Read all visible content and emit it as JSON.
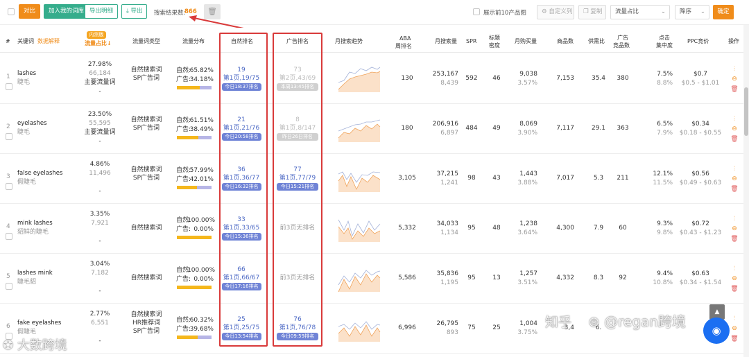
{
  "toolbar": {
    "btn_compare": "对比",
    "btn_add_library": "加入我的词库",
    "btn_export_detail": "导出明细",
    "btn_export": "导出",
    "search_result_label": "搜索结果数:",
    "search_result_count": "866",
    "show_top10": "展示前10产品图",
    "custom_columns": "自定义列",
    "copy": "复制",
    "sort_field": "流量占比",
    "sort_order": "降序",
    "confirm": "确定"
  },
  "headers": {
    "index": "#",
    "keyword": "关键词",
    "data_explain": "数据解释",
    "traffic_share": "流量占比",
    "internal_badge": "内测版",
    "traffic_type": "流量词类型",
    "traffic_dist": "流量分布",
    "natural_rank": "自然排名",
    "ad_rank": "广告排名",
    "monthly_trend": "月搜索趋势",
    "aba_1": "ABA",
    "aba_2": "周排名",
    "monthly_search": "月搜索量",
    "spr": "SPR",
    "title_1": "标题",
    "title_2": "密度",
    "monthly_buy": "月购买量",
    "products": "商品数",
    "supply_demand": "供需比",
    "ad_1": "广告",
    "ad_2": "竞品数",
    "click_1": "点击",
    "click_2": "集中度",
    "ppc": "PPC竞价",
    "ops": "操作"
  },
  "rows": [
    {
      "idx": "1",
      "kw": "lashes",
      "kw_cn": "睫毛",
      "share": "27.98%",
      "share_num": "66,184",
      "share_tag": "主要流量词",
      "share_dash": "-",
      "types": [
        "自然搜索词",
        "SP广告词"
      ],
      "nat_label": "自然:",
      "nat_pct": "65.82%",
      "ad_label": "广告:",
      "ad_pct": "34.18%",
      "nat_fill": 0.658,
      "nr_num": "19",
      "nr_page": "第1页,19/75",
      "nr_time": "今日18:37排名",
      "ar_num": "73",
      "ar_page": "第2页,43/69",
      "ar_time": "本周13:45排名",
      "ar_muted": true,
      "aba": "130",
      "ms": "253,167",
      "ms_sub": "8,439",
      "spr": "592",
      "td": "46",
      "mb": "9,038",
      "mb_pct": "3.57%",
      "prod": "7,153",
      "sd": "35.4",
      "adc": "380",
      "cc1": "7.5%",
      "cc2": "8.8%",
      "ppc": "$0.7",
      "ppc_range": "$0.5 - $1.01"
    },
    {
      "idx": "2",
      "kw": "eyelashes",
      "kw_cn": "睫毛",
      "share": "23.50%",
      "share_num": "55,595",
      "share_tag": "主要流量词",
      "share_dash": "-",
      "types": [
        "自然搜索词",
        "SP广告词"
      ],
      "nat_label": "自然:",
      "nat_pct": "61.51%",
      "ad_label": "广告:",
      "ad_pct": "38.49%",
      "nat_fill": 0.615,
      "nr_num": "21",
      "nr_page": "第1页,21/76",
      "nr_time": "今日20:58排名",
      "ar_num": "8",
      "ar_page": "第1页,8/147",
      "ar_time": "昨日26日排名",
      "ar_muted": true,
      "aba": "180",
      "ms": "206,916",
      "ms_sub": "6,897",
      "spr": "484",
      "td": "49",
      "mb": "8,069",
      "mb_pct": "3.90%",
      "prod": "7,117",
      "sd": "29.1",
      "adc": "363",
      "cc1": "6.5%",
      "cc2": "7.9%",
      "ppc": "$0.34",
      "ppc_range": "$0.18 - $0.55"
    },
    {
      "idx": "3",
      "kw": "false eyelashes",
      "kw_cn": "假睫毛",
      "share": "4.86%",
      "share_num": "11,496",
      "share_tag": "",
      "share_dash": "-",
      "types": [
        "自然搜索词",
        "SP广告词"
      ],
      "nat_label": "自然:",
      "nat_pct": "57.99%",
      "ad_label": "广告:",
      "ad_pct": "42.01%",
      "nat_fill": 0.58,
      "nr_num": "36",
      "nr_page": "第1页,36/77",
      "nr_time": "今日16:32排名",
      "ar_num": "77",
      "ar_page": "第1页,77/79",
      "ar_time": "今日15:21排名",
      "ar_muted": false,
      "aba": "3,105",
      "ms": "37,215",
      "ms_sub": "1,241",
      "spr": "98",
      "td": "43",
      "mb": "1,443",
      "mb_pct": "3.88%",
      "prod": "7,017",
      "sd": "5.3",
      "adc": "211",
      "cc1": "12.1%",
      "cc2": "11.5%",
      "ppc": "$0.56",
      "ppc_range": "$0.49 - $0.63"
    },
    {
      "idx": "4",
      "kw": "mink lashes",
      "kw_cn": "貂鲜的睫毛",
      "share": "3.35%",
      "share_num": "7,921",
      "share_tag": "",
      "share_dash": "-",
      "types": [
        "自然搜索词"
      ],
      "nat_label": "自然:",
      "nat_pct": "100.00%",
      "ad_label": "广告:",
      "ad_pct": "0.00%",
      "nat_fill": 1.0,
      "nr_num": "33",
      "nr_page": "第1页,33/65",
      "nr_time": "今日15:36排名",
      "ar_text": "前3页无排名",
      "aba": "5,332",
      "ms": "34,033",
      "ms_sub": "1,134",
      "spr": "95",
      "td": "48",
      "mb": "1,238",
      "mb_pct": "3.64%",
      "prod": "4,300",
      "sd": "7.9",
      "adc": "60",
      "cc1": "9.3%",
      "cc2": "9.8%",
      "ppc": "$0.72",
      "ppc_range": "$0.43 - $1.23"
    },
    {
      "idx": "5",
      "kw": "lashes mink",
      "kw_cn": "睫毛貂",
      "share": "3.04%",
      "share_num": "7,182",
      "share_tag": "",
      "share_dash": "-",
      "types": [
        "自然搜索词"
      ],
      "nat_label": "自然:",
      "nat_pct": "100.00%",
      "ad_label": "广告:",
      "ad_pct": "0.00%",
      "nat_fill": 1.0,
      "nr_num": "66",
      "nr_page": "第1页,66/67",
      "nr_time": "今日17:16排名",
      "ar_text": "前3页无排名",
      "aba": "5,586",
      "ms": "35,836",
      "ms_sub": "1,195",
      "spr": "95",
      "td": "13",
      "mb": "1,257",
      "mb_pct": "3.51%",
      "prod": "4,332",
      "sd": "8.3",
      "adc": "92",
      "cc1": "9.4%",
      "cc2": "10.8%",
      "ppc": "$0.63",
      "ppc_range": "$0.34 - $1.54"
    },
    {
      "idx": "6",
      "kw": "fake eyelashes",
      "kw_cn": "假睫毛",
      "share": "2.77%",
      "share_num": "6,551",
      "share_tag": "",
      "share_dash": "-",
      "types": [
        "自然搜索词",
        "HR推荐词",
        "SP广告词"
      ],
      "nat_label": "自然:",
      "nat_pct": "60.32%",
      "ad_label": "广告:",
      "ad_pct": "39.68%",
      "nat_fill": 0.603,
      "nr_num": "25",
      "nr_page": "第1页,25/75",
      "nr_time": "今日13:54排名",
      "ar_num": "76",
      "ar_page": "第1页,76/78",
      "ar_time": "今日09:59排名",
      "ar_muted": false,
      "aba": "6,996",
      "ms": "26,795",
      "ms_sub": "893",
      "spr": "75",
      "td": "25",
      "mb": "1,004",
      "mb_pct": "3.75%",
      "prod": "3,4",
      "sd": "6.",
      "adc": "",
      "cc1": "",
      "cc2": "",
      "ppc": "",
      "ppc_range": ""
    }
  ],
  "colors": {
    "accent": "#f08c1a",
    "green": "#35ad8c",
    "link": "#4a67c4",
    "pill": "#6f83d6",
    "highlight": "#d93a3a"
  },
  "watermarks": {
    "zhihu": "知乎",
    "wechat": "@regan跨境",
    "logo": "大数跨境"
  }
}
